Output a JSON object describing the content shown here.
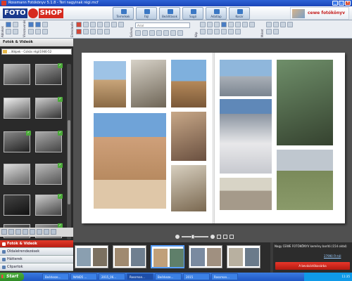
{
  "window": {
    "title": "Rossmann Fotókönyv 5.1.8 - Teri nagyinak régi.mcf"
  },
  "brand": {
    "logo_left": "FOTO",
    "logo_right": "SHOP",
    "partner": "cewe fotókönyv"
  },
  "topnav": [
    {
      "label": "Termékek",
      "icon": "product-icon"
    },
    {
      "label": "Fájl",
      "icon": "file-icon"
    },
    {
      "label": "Beállítások",
      "icon": "settings-icon"
    },
    {
      "label": "Súgó",
      "icon": "help-icon"
    },
    {
      "label": "Adatlap",
      "icon": "info-icon"
    },
    {
      "label": "Kosár",
      "icon": "cart-icon"
    }
  ],
  "toolbar": {
    "font_value": "Arial",
    "group_labels": [
      "Ablakok",
      "Visszavonás",
      "Elrendezés",
      "Szöveg",
      "Kép",
      "Méret"
    ]
  },
  "left_panel": {
    "title": "Fotók & Videók",
    "path": "...\\Képek - Csikós régi(1946-52",
    "tabs": [
      {
        "label": "Fotók & Videók",
        "active": true
      },
      {
        "label": "Oldalelrendezések",
        "active": false
      },
      {
        "label": "Hátterek",
        "active": false
      },
      {
        "label": "Clipartok",
        "active": false
      }
    ]
  },
  "info_panel": {
    "description": "Nagy CEWE FOTÓKÖNYV kemény borító (154 oldal)",
    "price": "27990 Ft-tól",
    "cart_button": "A bevásárlókosárba"
  },
  "taskbar": {
    "start": "Start",
    "tasks": [
      "Beérkeze...",
      "NAND5 ...",
      "2015_06...",
      "Rossman...",
      "Beérkeze...",
      "2015",
      "Rossman..."
    ],
    "clock": "11:35"
  },
  "colors": {
    "accent_red": "#d62a1f",
    "brand_blue": "#1a3a8c",
    "check_green": "#4caa3a"
  }
}
